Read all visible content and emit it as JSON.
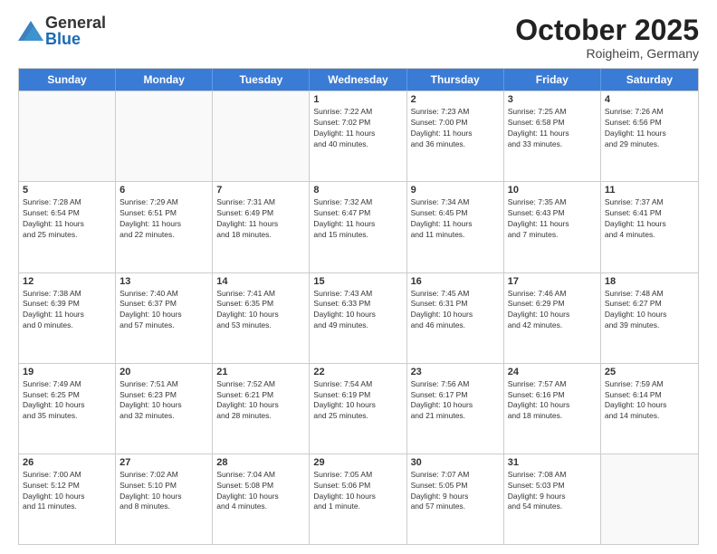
{
  "header": {
    "logo_general": "General",
    "logo_blue": "Blue",
    "month_title": "October 2025",
    "location": "Roigheim, Germany"
  },
  "calendar": {
    "days_of_week": [
      "Sunday",
      "Monday",
      "Tuesday",
      "Wednesday",
      "Thursday",
      "Friday",
      "Saturday"
    ],
    "weeks": [
      [
        {
          "day": "",
          "info": ""
        },
        {
          "day": "",
          "info": ""
        },
        {
          "day": "",
          "info": ""
        },
        {
          "day": "1",
          "info": "Sunrise: 7:22 AM\nSunset: 7:02 PM\nDaylight: 11 hours\nand 40 minutes."
        },
        {
          "day": "2",
          "info": "Sunrise: 7:23 AM\nSunset: 7:00 PM\nDaylight: 11 hours\nand 36 minutes."
        },
        {
          "day": "3",
          "info": "Sunrise: 7:25 AM\nSunset: 6:58 PM\nDaylight: 11 hours\nand 33 minutes."
        },
        {
          "day": "4",
          "info": "Sunrise: 7:26 AM\nSunset: 6:56 PM\nDaylight: 11 hours\nand 29 minutes."
        }
      ],
      [
        {
          "day": "5",
          "info": "Sunrise: 7:28 AM\nSunset: 6:54 PM\nDaylight: 11 hours\nand 25 minutes."
        },
        {
          "day": "6",
          "info": "Sunrise: 7:29 AM\nSunset: 6:51 PM\nDaylight: 11 hours\nand 22 minutes."
        },
        {
          "day": "7",
          "info": "Sunrise: 7:31 AM\nSunset: 6:49 PM\nDaylight: 11 hours\nand 18 minutes."
        },
        {
          "day": "8",
          "info": "Sunrise: 7:32 AM\nSunset: 6:47 PM\nDaylight: 11 hours\nand 15 minutes."
        },
        {
          "day": "9",
          "info": "Sunrise: 7:34 AM\nSunset: 6:45 PM\nDaylight: 11 hours\nand 11 minutes."
        },
        {
          "day": "10",
          "info": "Sunrise: 7:35 AM\nSunset: 6:43 PM\nDaylight: 11 hours\nand 7 minutes."
        },
        {
          "day": "11",
          "info": "Sunrise: 7:37 AM\nSunset: 6:41 PM\nDaylight: 11 hours\nand 4 minutes."
        }
      ],
      [
        {
          "day": "12",
          "info": "Sunrise: 7:38 AM\nSunset: 6:39 PM\nDaylight: 11 hours\nand 0 minutes."
        },
        {
          "day": "13",
          "info": "Sunrise: 7:40 AM\nSunset: 6:37 PM\nDaylight: 10 hours\nand 57 minutes."
        },
        {
          "day": "14",
          "info": "Sunrise: 7:41 AM\nSunset: 6:35 PM\nDaylight: 10 hours\nand 53 minutes."
        },
        {
          "day": "15",
          "info": "Sunrise: 7:43 AM\nSunset: 6:33 PM\nDaylight: 10 hours\nand 49 minutes."
        },
        {
          "day": "16",
          "info": "Sunrise: 7:45 AM\nSunset: 6:31 PM\nDaylight: 10 hours\nand 46 minutes."
        },
        {
          "day": "17",
          "info": "Sunrise: 7:46 AM\nSunset: 6:29 PM\nDaylight: 10 hours\nand 42 minutes."
        },
        {
          "day": "18",
          "info": "Sunrise: 7:48 AM\nSunset: 6:27 PM\nDaylight: 10 hours\nand 39 minutes."
        }
      ],
      [
        {
          "day": "19",
          "info": "Sunrise: 7:49 AM\nSunset: 6:25 PM\nDaylight: 10 hours\nand 35 minutes."
        },
        {
          "day": "20",
          "info": "Sunrise: 7:51 AM\nSunset: 6:23 PM\nDaylight: 10 hours\nand 32 minutes."
        },
        {
          "day": "21",
          "info": "Sunrise: 7:52 AM\nSunset: 6:21 PM\nDaylight: 10 hours\nand 28 minutes."
        },
        {
          "day": "22",
          "info": "Sunrise: 7:54 AM\nSunset: 6:19 PM\nDaylight: 10 hours\nand 25 minutes."
        },
        {
          "day": "23",
          "info": "Sunrise: 7:56 AM\nSunset: 6:17 PM\nDaylight: 10 hours\nand 21 minutes."
        },
        {
          "day": "24",
          "info": "Sunrise: 7:57 AM\nSunset: 6:16 PM\nDaylight: 10 hours\nand 18 minutes."
        },
        {
          "day": "25",
          "info": "Sunrise: 7:59 AM\nSunset: 6:14 PM\nDaylight: 10 hours\nand 14 minutes."
        }
      ],
      [
        {
          "day": "26",
          "info": "Sunrise: 7:00 AM\nSunset: 5:12 PM\nDaylight: 10 hours\nand 11 minutes."
        },
        {
          "day": "27",
          "info": "Sunrise: 7:02 AM\nSunset: 5:10 PM\nDaylight: 10 hours\nand 8 minutes."
        },
        {
          "day": "28",
          "info": "Sunrise: 7:04 AM\nSunset: 5:08 PM\nDaylight: 10 hours\nand 4 minutes."
        },
        {
          "day": "29",
          "info": "Sunrise: 7:05 AM\nSunset: 5:06 PM\nDaylight: 10 hours\nand 1 minute."
        },
        {
          "day": "30",
          "info": "Sunrise: 7:07 AM\nSunset: 5:05 PM\nDaylight: 9 hours\nand 57 minutes."
        },
        {
          "day": "31",
          "info": "Sunrise: 7:08 AM\nSunset: 5:03 PM\nDaylight: 9 hours\nand 54 minutes."
        },
        {
          "day": "",
          "info": ""
        }
      ]
    ]
  }
}
